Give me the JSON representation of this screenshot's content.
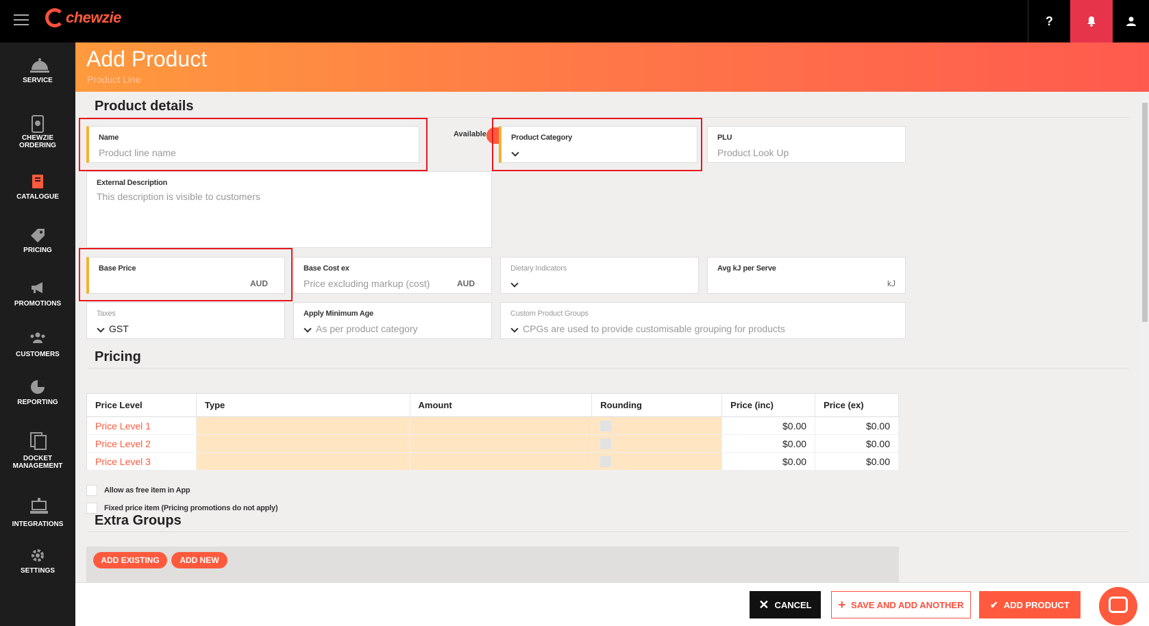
{
  "app": {
    "logo_text": "chewzie",
    "brand_color": "#ff5a3d"
  },
  "topbar": {
    "help_label": "?",
    "icons": [
      "menu-icon",
      "question-icon",
      "bell-icon",
      "user-icon"
    ]
  },
  "sidebar": {
    "items": [
      {
        "label": "SERVICE",
        "icon": "service-icon"
      },
      {
        "label": "CHEWZIE\nORDERING",
        "icon": "phone-icon"
      },
      {
        "label": "CATALOGUE",
        "icon": "book-icon"
      },
      {
        "label": "PRICING",
        "icon": "tag-icon"
      },
      {
        "label": "PROMOTIONS",
        "icon": "megaphone-icon"
      },
      {
        "label": "CUSTOMERS",
        "icon": "people-icon"
      },
      {
        "label": "REPORTING",
        "icon": "pie-chart-icon"
      },
      {
        "label": "DOCKET\nMANAGEMENT",
        "icon": "docket-icon"
      },
      {
        "label": "INTEGRATIONS",
        "icon": "integrations-icon"
      },
      {
        "label": "SETTINGS",
        "icon": "gear-icon"
      }
    ]
  },
  "header": {
    "title": "Add Product",
    "subtitle": "Product Line"
  },
  "product_details": {
    "title": "Product details",
    "name": {
      "label": "Name",
      "placeholder": "Product line name"
    },
    "available": {
      "label": "Available",
      "on": true
    },
    "category": {
      "label": "Product Category"
    },
    "plu": {
      "label": "PLU",
      "placeholder": "Product Look Up"
    },
    "external_description": {
      "label": "External Description",
      "placeholder": "This description is visible to customers"
    },
    "base_price": {
      "label": "Base Price",
      "unit": "AUD"
    },
    "base_cost": {
      "label": "Base Cost ex",
      "placeholder": "Price excluding markup (cost)",
      "unit": "AUD"
    },
    "dietary": {
      "label": "Dietary Indicators"
    },
    "avg_kj": {
      "label": "Avg kJ per Serve",
      "unit": "kJ"
    },
    "taxes": {
      "label": "Taxes",
      "value": "GST"
    },
    "min_age": {
      "label": "Apply Minimum Age",
      "placeholder": "As per product category"
    },
    "cpg": {
      "label": "Custom Product Groups",
      "placeholder": "CPGs are used to provide customisable grouping for products"
    }
  },
  "pricing": {
    "title": "Pricing",
    "columns": [
      "Price Level",
      "Type",
      "Amount",
      "Rounding",
      "Price (inc)",
      "Price (ex)"
    ],
    "rows": [
      {
        "level": "Price Level 1",
        "price_inc": "$0.00",
        "price_ex": "$0.00"
      },
      {
        "level": "Price Level 2",
        "price_inc": "$0.00",
        "price_ex": "$0.00"
      },
      {
        "level": "Price Level 3",
        "price_inc": "$0.00",
        "price_ex": "$0.00"
      }
    ],
    "allow_free_label": "Allow as free item in App",
    "fixed_price_label": "Fixed price item (Pricing promotions do not apply)"
  },
  "extra_groups": {
    "title": "Extra Groups",
    "add_existing": "ADD EXISTING",
    "add_new": "ADD NEW"
  },
  "footer": {
    "cancel": "CANCEL",
    "save_another": "SAVE AND ADD ANOTHER",
    "add_product": "ADD PRODUCT"
  }
}
